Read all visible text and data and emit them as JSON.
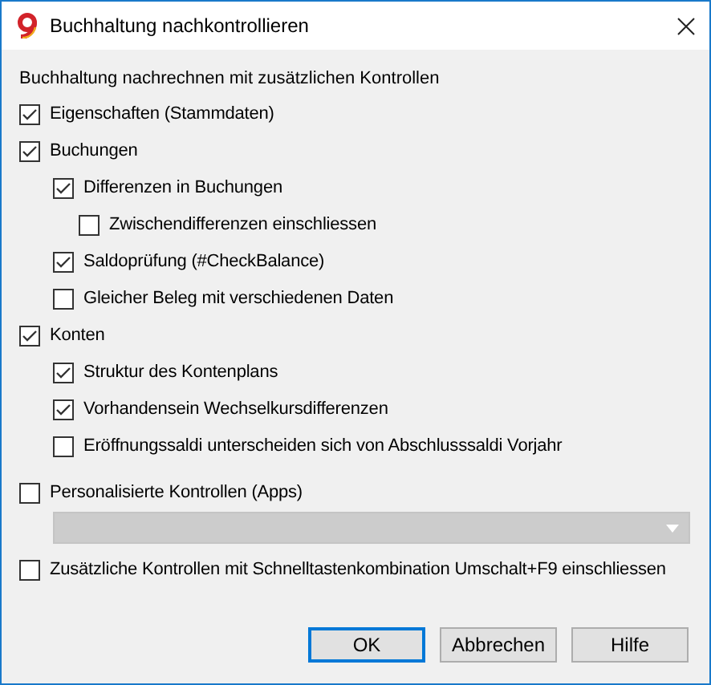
{
  "window": {
    "title": "Buchhaltung nachkontrollieren"
  },
  "intro": "Buchhaltung nachrechnen mit zusätzlichen Kontrollen",
  "checks": [
    {
      "label": "Eigenschaften (Stammdaten)",
      "checked": true
    },
    {
      "label": "Buchungen",
      "checked": true,
      "children": [
        {
          "label": "Differenzen in Buchungen",
          "checked": true,
          "children": [
            {
              "label": "Zwischendifferenzen einschliessen",
              "checked": false
            }
          ]
        },
        {
          "label": "Saldoprüfung (#CheckBalance)",
          "checked": true
        },
        {
          "label": "Gleicher Beleg mit verschiedenen Daten",
          "checked": false
        }
      ]
    },
    {
      "label": "Konten",
      "checked": true,
      "children": [
        {
          "label": "Struktur des Kontenplans",
          "checked": true
        },
        {
          "label": "Vorhandensein Wechselkursdifferenzen",
          "checked": true
        },
        {
          "label": "Eröffnungssaldi unterscheiden sich von Abschlusssaldi Vorjahr",
          "checked": false
        }
      ]
    }
  ],
  "custom": {
    "label": "Personalisierte Kontrollen (Apps)",
    "checked": false,
    "dropdown": {
      "disabled": true
    }
  },
  "shortcut": {
    "label": "Zusätzliche Kontrollen mit Schnelltastenkombination Umschalt+F9 einschliessen",
    "checked": false
  },
  "buttons": [
    {
      "label": "OK",
      "default": true
    },
    {
      "label": "Abbrechen",
      "default": false
    },
    {
      "label": "Hilfe",
      "default": false
    }
  ]
}
